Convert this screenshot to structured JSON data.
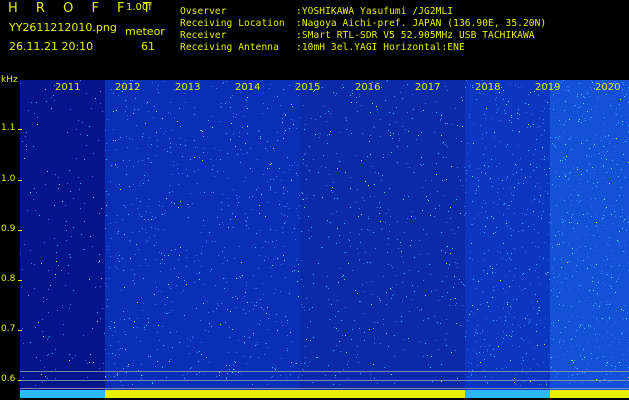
{
  "header": {
    "app_title": "HROFFT",
    "version": "1.00f",
    "filename": "YY2611212010.png",
    "datetime": "26.11.21 20:10",
    "mode_label": "meteor",
    "mode_count": "61",
    "info": [
      {
        "label": "Ovserver",
        "value": ":YOSHIKAWA Yasufumi /JG2MLI"
      },
      {
        "label": "Receiving Location",
        "value": ":Nagoya Aichi-pref. JAPAN (136.90E, 35.20N)"
      },
      {
        "label": "Receiver",
        "value": ":SMart RTL-SDR V5 52.905MHz USB TACHIKAWA"
      },
      {
        "label": "Receiving Antenna",
        "value": ":10mH 3el.YAGI Horizontal:ENE"
      }
    ]
  },
  "spectrogram": {
    "axis_unit": "kHz",
    "y_ticks": [
      "1.1",
      "1.0",
      "0.9",
      "0.8",
      "0.7",
      "0.6"
    ],
    "x_labels": [
      "2011",
      "2012",
      "2013",
      "2014",
      "2015",
      "2016",
      "2017",
      "2018",
      "2019",
      "2020"
    ],
    "colors": {
      "background": "#021066",
      "signal": "#e8f000",
      "noise": "#3a6cff"
    }
  }
}
